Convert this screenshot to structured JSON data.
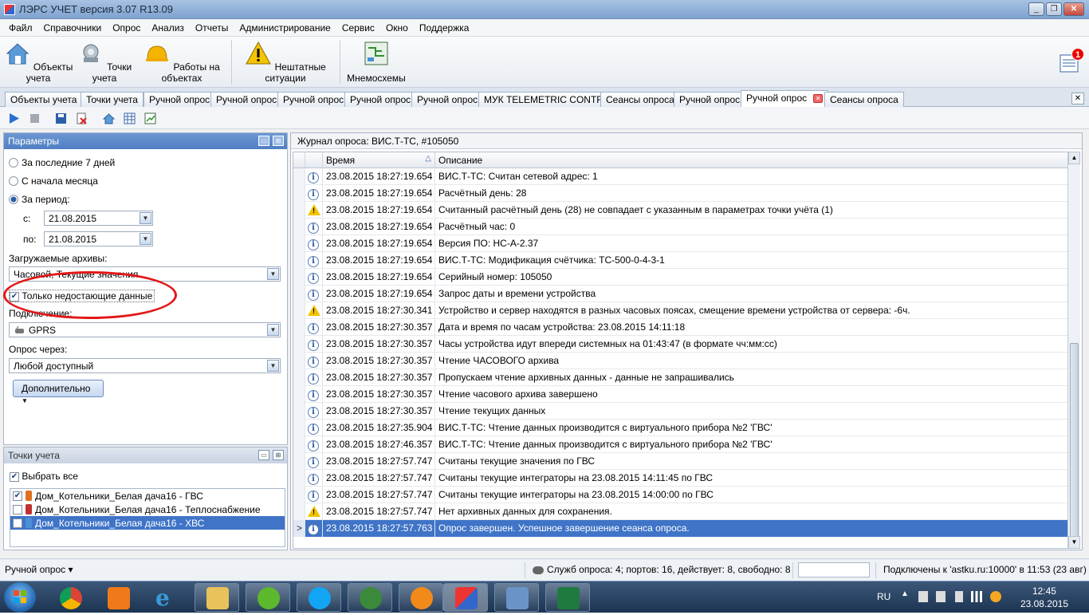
{
  "window": {
    "title": "ЛЭРС УЧЕТ версия 3.07 R13.09"
  },
  "menu": [
    "Файл",
    "Справочники",
    "Опрос",
    "Анализ",
    "Отчеты",
    "Администрирование",
    "Сервис",
    "Окно",
    "Поддержка"
  ],
  "ribbon": {
    "objects": "Объекты учета",
    "points": "Точки учета",
    "works": "Работы на объектах",
    "incidents": "Нештатные ситуации",
    "mnemo": "Мнемосхемы",
    "notify_count": "1"
  },
  "tabs": [
    "Объекты учета",
    "Точки учета",
    "Ручной опрос",
    "Ручной опрос",
    "Ручной опрос",
    "Ручной опрос",
    "Ручной опрос",
    "МУК TELEMETRIC CONTROL",
    "Сеансы опроса",
    "Ручной опрос",
    "Ручной опрос",
    "Сеансы опроса"
  ],
  "params": {
    "header": "Параметры",
    "opt_last7": "За последние 7 дней",
    "opt_month": "С начала месяца",
    "opt_period": "За период:",
    "from_label": "с:",
    "from_value": "21.08.2015",
    "to_label": "по:",
    "to_value": "21.08.2015",
    "archives_label": "Загружаемые архивы:",
    "archives_value": "Часовой, Текущие значения",
    "only_missing": "Только недостающие данные",
    "conn_label": "Подключение:",
    "conn_value": "GPRS",
    "via_label": "Опрос через:",
    "via_value": "Любой доступный",
    "more_button": "Дополнительно"
  },
  "points": {
    "header": "Точки учета",
    "select_all": "Выбрать все",
    "items": [
      {
        "label": "Дом_Котельники_Белая дача16 - ГВС",
        "checked": true,
        "color": "#e07020"
      },
      {
        "label": "Дом_Котельники_Белая дача16 - Теплоснабжение",
        "checked": false,
        "color": "#c03030"
      },
      {
        "label": "Дом_Котельники_Белая дача16 - ХВС",
        "checked": false,
        "color": "#4a8fd8"
      }
    ]
  },
  "journal": {
    "title": "Журнал опроса: ВИС.Т-ТС, #105050",
    "col_time": "Время",
    "col_desc": "Описание",
    "rows": [
      {
        "type": "info",
        "time": "23.08.2015 18:27:19.654",
        "desc": "ВИС.Т-ТС: Считан сетевой адрес: 1"
      },
      {
        "type": "info",
        "time": "23.08.2015 18:27:19.654",
        "desc": "Расчётный день: 28"
      },
      {
        "type": "warn",
        "time": "23.08.2015 18:27:19.654",
        "desc": "Считанный расчётный день (28) не совпадает с указанным в параметрах точки учёта (1)"
      },
      {
        "type": "info",
        "time": "23.08.2015 18:27:19.654",
        "desc": "Расчётный час: 0"
      },
      {
        "type": "info",
        "time": "23.08.2015 18:27:19.654",
        "desc": "Версия ПО: НС-А-2.37"
      },
      {
        "type": "info",
        "time": "23.08.2015 18:27:19.654",
        "desc": "ВИС.Т-ТС: Модификация счётчика: ТС-500-0-4-3-1"
      },
      {
        "type": "info",
        "time": "23.08.2015 18:27:19.654",
        "desc": "Серийный номер: 105050"
      },
      {
        "type": "info",
        "time": "23.08.2015 18:27:19.654",
        "desc": "Запрос даты и времени устройства"
      },
      {
        "type": "warn",
        "time": "23.08.2015 18:27:30.341",
        "desc": "Устройство и сервер находятся в разных часовых поясах, смещение времени устройства от сервера: -6ч."
      },
      {
        "type": "info",
        "time": "23.08.2015 18:27:30.357",
        "desc": "Дата и время по часам устройства: 23.08.2015 14:11:18"
      },
      {
        "type": "info",
        "time": "23.08.2015 18:27:30.357",
        "desc": "Часы устройства идут впереди системных на 01:43:47 (в формате чч:мм:сс)"
      },
      {
        "type": "info",
        "time": "23.08.2015 18:27:30.357",
        "desc": "Чтение ЧАСОВОГО архива"
      },
      {
        "type": "info",
        "time": "23.08.2015 18:27:30.357",
        "desc": "Пропускаем чтение архивных данных - данные не запрашивались"
      },
      {
        "type": "info",
        "time": "23.08.2015 18:27:30.357",
        "desc": "Чтение часового архива завершено"
      },
      {
        "type": "info",
        "time": "23.08.2015 18:27:30.357",
        "desc": "Чтение текущих данных"
      },
      {
        "type": "info",
        "time": "23.08.2015 18:27:35.904",
        "desc": "ВИС.Т-ТС: Чтение данных производится с виртуального прибора №2 'ГВС'"
      },
      {
        "type": "info",
        "time": "23.08.2015 18:27:46.357",
        "desc": "ВИС.Т-ТС: Чтение данных производится с виртуального прибора №2 'ГВС'"
      },
      {
        "type": "info",
        "time": "23.08.2015 18:27:57.747",
        "desc": "Считаны текущие значения по ГВС"
      },
      {
        "type": "info",
        "time": "23.08.2015 18:27:57.747",
        "desc": "Считаны текущие интеграторы на 23.08.2015 14:11:45 по ГВС"
      },
      {
        "type": "info",
        "time": "23.08.2015 18:27:57.747",
        "desc": "Считаны текущие интеграторы на 23.08.2015 14:00:00 по ГВС"
      },
      {
        "type": "warn",
        "time": "23.08.2015 18:27:57.747",
        "desc": "Нет архивных данных для сохранения."
      },
      {
        "type": "info",
        "time": "23.08.2015 18:27:57.763",
        "desc": "Опрос завершен. Успешное завершение сеанса опроса.",
        "selected": true
      }
    ]
  },
  "status": {
    "mode": "Ручной опрос ▾",
    "services": "Служб опроса: 4; портов: 16, действует: 8, свободно: 8",
    "connected": "Подключены к 'astku.ru:10000' в 11:53 (23 авг)"
  },
  "taskbar": {
    "lang": "RU",
    "time": "12:45",
    "date": "23.08.2015"
  },
  "colors": {
    "accent": "#3f74c7",
    "annotation": "#e21717"
  }
}
